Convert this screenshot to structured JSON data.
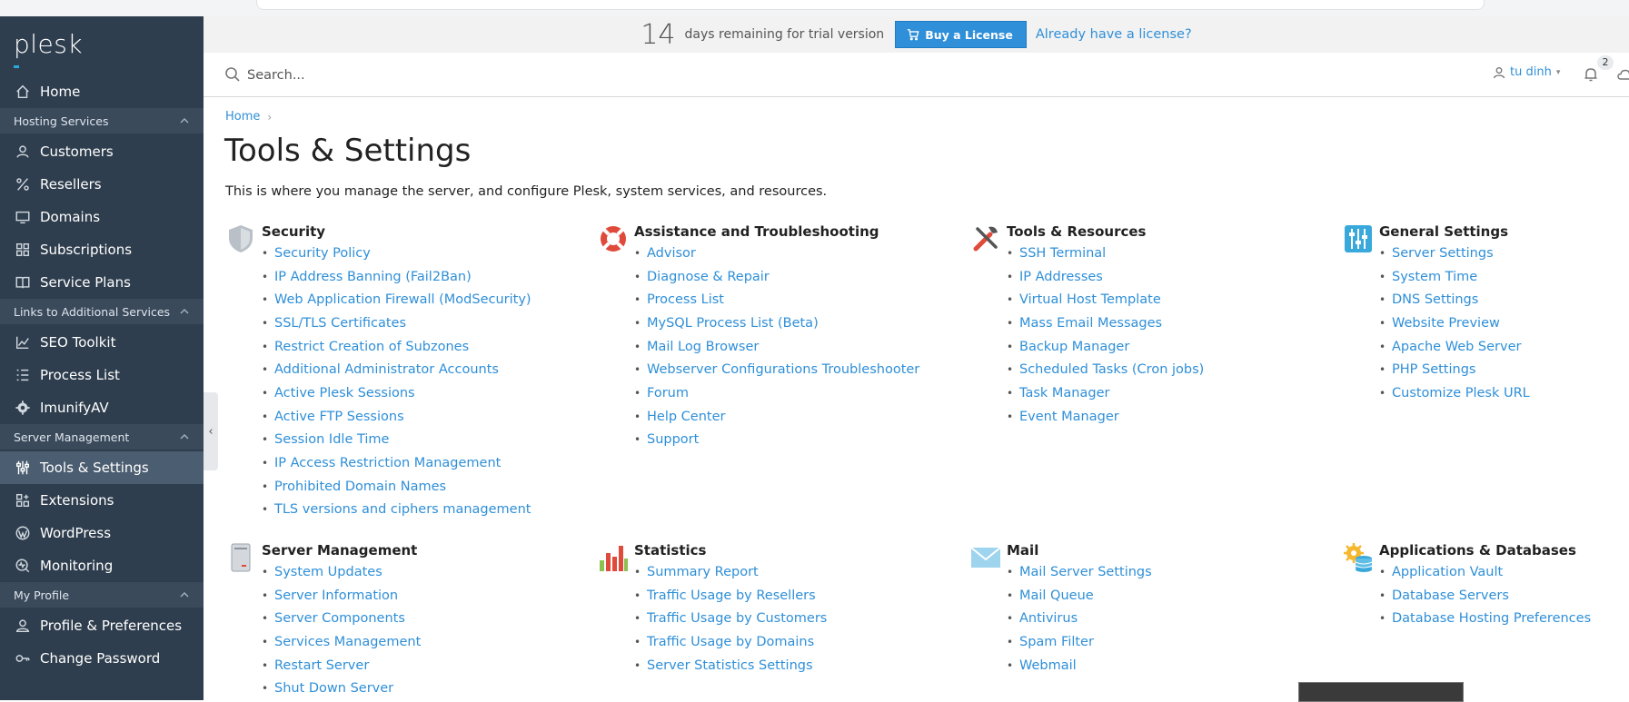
{
  "sidebar": {
    "logo": "plesk",
    "items": {
      "home": "Home",
      "group_hosting": "Hosting Services",
      "customers": "Customers",
      "resellers": "Resellers",
      "domains": "Domains",
      "subscriptions": "Subscriptions",
      "service_plans": "Service Plans",
      "group_links": "Links to Additional Services",
      "seo": "SEO Toolkit",
      "process_list": "Process List",
      "imunify": "ImunifyAV",
      "group_server": "Server Management",
      "tools": "Tools & Settings",
      "extensions": "Extensions",
      "wordpress": "WordPress",
      "monitoring": "Monitoring",
      "group_profile": "My Profile",
      "profile": "Profile & Preferences",
      "change_password": "Change Password"
    }
  },
  "trial": {
    "days": "14",
    "text": "days remaining for trial version",
    "buy": "Buy a License",
    "have": "Already have a license?"
  },
  "search": {
    "placeholder": "Search..."
  },
  "header": {
    "user": "tu dinh",
    "notifications": "2"
  },
  "breadcrumb": {
    "home": "Home"
  },
  "page": {
    "title": "Tools & Settings",
    "description": "This is where you manage the server, and configure Plesk, system services, and resources."
  },
  "sections": {
    "security": {
      "title": "Security",
      "links": [
        "Security Policy",
        "IP Address Banning (Fail2Ban)",
        "Web Application Firewall (ModSecurity)",
        "SSL/TLS Certificates",
        "Restrict Creation of Subzones",
        "Additional Administrator Accounts",
        "Active Plesk Sessions",
        "Active FTP Sessions",
        "Session Idle Time",
        "IP Access Restriction Management",
        "Prohibited Domain Names",
        "TLS versions and ciphers management"
      ]
    },
    "assistance": {
      "title": "Assistance and Troubleshooting",
      "links": [
        "Advisor",
        "Diagnose & Repair",
        "Process List",
        "MySQL Process List (Beta)",
        "Mail Log Browser",
        "Webserver Configurations Troubleshooter",
        "Forum",
        "Help Center",
        "Support"
      ]
    },
    "tools": {
      "title": "Tools & Resources",
      "links": [
        "SSH Terminal",
        "IP Addresses",
        "Virtual Host Template",
        "Mass Email Messages",
        "Backup Manager",
        "Scheduled Tasks (Cron jobs)",
        "Task Manager",
        "Event Manager"
      ]
    },
    "general": {
      "title": "General Settings",
      "links": [
        "Server Settings",
        "System Time",
        "DNS Settings",
        "Website Preview",
        "Apache Web Server",
        "PHP Settings",
        "Customize Plesk URL"
      ]
    },
    "server": {
      "title": "Server Management",
      "links": [
        "System Updates",
        "Server Information",
        "Server Components",
        "Services Management",
        "Restart Server",
        "Shut Down Server"
      ]
    },
    "statistics": {
      "title": "Statistics",
      "links": [
        "Summary Report",
        "Traffic Usage by Resellers",
        "Traffic Usage by Customers",
        "Traffic Usage by Domains",
        "Server Statistics Settings"
      ]
    },
    "mail": {
      "title": "Mail",
      "links": [
        "Mail Server Settings",
        "Mail Queue",
        "Antivirus",
        "Spam Filter",
        "Webmail"
      ]
    },
    "apps": {
      "title": "Applications & Databases",
      "links": [
        "Application Vault",
        "Database Servers",
        "Database Hosting Preferences"
      ]
    }
  },
  "colors": {
    "sidebar": "#2f3e4e",
    "accent": "#2f8fd8",
    "active": "#4b5d70"
  }
}
